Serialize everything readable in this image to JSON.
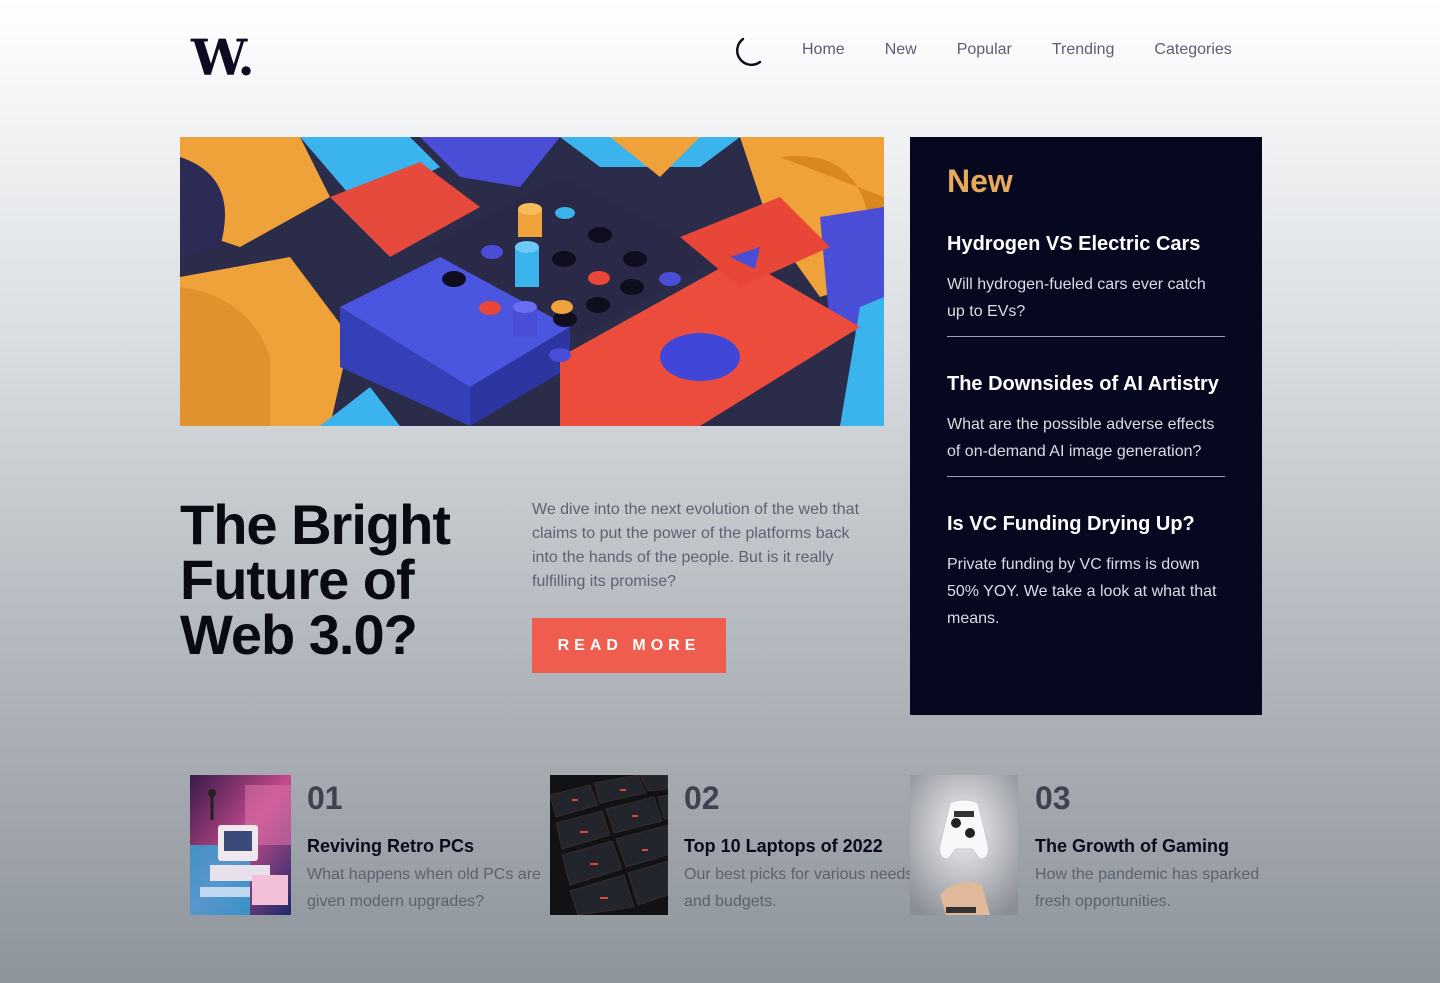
{
  "logo": "W.",
  "icons": {
    "theme_toggle": "moon-icon"
  },
  "nav": [
    "Home",
    "New",
    "Popular",
    "Trending",
    "Categories"
  ],
  "hero": {
    "title": "The Bright Future of Web 3.0?",
    "description": "We dive into the next evolution of the web that claims to put the power of the platforms back into the hands of the people. But is it really fulfilling its promise?",
    "button": "READ MORE"
  },
  "new_panel": {
    "heading": "New",
    "items": [
      {
        "title": "Hydrogen VS Electric Cars",
        "desc": "Will hydrogen-fueled cars ever catch up to EVs?"
      },
      {
        "title": "The Downsides of AI Artistry",
        "desc": "What are the possible adverse effects of on-demand AI image generation?"
      },
      {
        "title": "Is VC Funding Drying Up?",
        "desc": "Private funding by VC firms is down 50% YOY. We take a look at what that means."
      }
    ]
  },
  "bottom": [
    {
      "num": "01",
      "title": "Reviving Retro PCs",
      "desc": "What happens when old PCs are given modern upgrades?"
    },
    {
      "num": "02",
      "title": "Top 10 Laptops of 2022",
      "desc": "Our best picks for various needs and budgets."
    },
    {
      "num": "03",
      "title": "The Growth of Gaming",
      "desc": "How the pandemic has sparked fresh opportunities."
    }
  ],
  "colors": {
    "accent": "#ef5d4e",
    "panel_bg": "#060820",
    "panel_heading": "#e8a95a"
  }
}
